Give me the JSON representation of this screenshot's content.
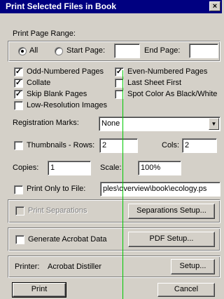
{
  "window": {
    "title": "Print Selected Files in Book",
    "close_glyph": "×"
  },
  "page_range": {
    "label": "Print Page Range:",
    "all_label": "All",
    "start_label": "Start Page:",
    "start_value": "",
    "end_label": "End Page:",
    "end_value": ""
  },
  "options": {
    "odd": {
      "label": "Odd-Numbered Pages",
      "checked": true
    },
    "even": {
      "label": "Even-Numbered Pages",
      "checked": true
    },
    "collate": {
      "label": "Collate",
      "checked": true
    },
    "last_first": {
      "label": "Last Sheet First",
      "checked": false
    },
    "skip_blank": {
      "label": "Skip Blank Pages",
      "checked": true
    },
    "spot_color": {
      "label": "Spot Color As Black/White",
      "checked": false
    },
    "low_res": {
      "label": "Low-Resolution Images",
      "checked": false
    }
  },
  "registration": {
    "label": "Registration Marks:",
    "value": "None"
  },
  "thumbnails": {
    "label": "Thumbnails - Rows:",
    "rows": "2",
    "cols_label": "Cols:",
    "cols": "2"
  },
  "copies": {
    "label": "Copies:",
    "value": "1"
  },
  "scale": {
    "label": "Scale:",
    "value": "100%"
  },
  "print_to_file": {
    "label": "Print Only to File:",
    "value": "ples\\overview\\book\\ecology.ps"
  },
  "separations": {
    "label": "Print Separations",
    "button": "Separations Setup..."
  },
  "acrobat": {
    "label": "Generate Acrobat Data",
    "button": "PDF Setup..."
  },
  "printer": {
    "label": "Printer:",
    "name": "Acrobat Distiller",
    "button": "Setup..."
  },
  "footer": {
    "print": "Print",
    "cancel": "Cancel"
  },
  "colors": {
    "title_bar": "#000080",
    "dialog_bg": "#d4d0c8",
    "guide_line": "#00c800"
  }
}
